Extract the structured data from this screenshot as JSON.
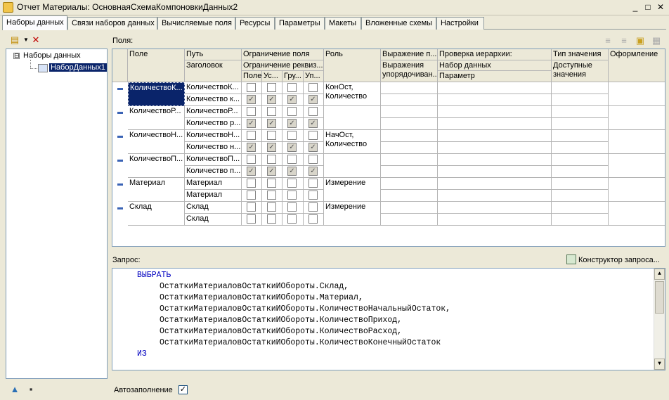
{
  "window": {
    "title": "Отчет Материалы: ОсновнаяСхемаКомпоновкиДанных2",
    "minimize": "_",
    "maximize": "□",
    "close": "✕"
  },
  "tabs": [
    {
      "label": "Наборы данных"
    },
    {
      "label": "Связи наборов данных"
    },
    {
      "label": "Вычисляемые поля"
    },
    {
      "label": "Ресурсы"
    },
    {
      "label": "Параметры"
    },
    {
      "label": "Макеты"
    },
    {
      "label": "Вложенные схемы"
    },
    {
      "label": "Настройки"
    }
  ],
  "tree": {
    "root": "Наборы данных",
    "child": "НаборДанных1",
    "expander": "⊟"
  },
  "fields_label": "Поля:",
  "grid": {
    "headers": {
      "field": "Поле",
      "path": "Путь",
      "title": "Заголовок",
      "field_restriction": "Ограничение поля",
      "attr_restriction": "Ограничение реквиз...",
      "sub_field": "Поле",
      "sub_cond": "Ус...",
      "sub_group": "Гру...",
      "sub_order": "Уп...",
      "role": "Роль",
      "expr": "Выражение п...",
      "expr_order": "Выражения упорядочиван...",
      "hier": "Проверка иерархии:",
      "hier_set": "Набор данных",
      "hier_param": "Параметр",
      "value_type": "Тип значения",
      "avail_values": "Доступные значения",
      "format": "Оформление"
    },
    "rows": [
      {
        "field": "КоличествоК...",
        "path": "КоличествоК...",
        "title": "Количество к...",
        "role": "КонОст, Количество",
        "top": [
          false,
          false,
          false,
          false
        ],
        "bottom": [
          true,
          true,
          true,
          true
        ],
        "selected": true
      },
      {
        "field": "КоличествоР...",
        "path": "КоличествоР...",
        "title": "Количество р...",
        "role": "",
        "top": [
          false,
          false,
          false,
          false
        ],
        "bottom": [
          true,
          true,
          true,
          true
        ],
        "selected": false
      },
      {
        "field": "КоличествоН...",
        "path": "КоличествоН...",
        "title": "Количество н...",
        "role": "НачОст, Количество",
        "top": [
          false,
          false,
          false,
          false
        ],
        "bottom": [
          true,
          true,
          true,
          true
        ],
        "selected": false
      },
      {
        "field": "КоличествоП...",
        "path": "КоличествоП...",
        "title": "Количество п...",
        "role": "",
        "top": [
          false,
          false,
          false,
          false
        ],
        "bottom": [
          true,
          true,
          true,
          true
        ],
        "selected": false
      },
      {
        "field": "Материал",
        "path": "Материал",
        "title": "Материал",
        "role": "Измерение",
        "top": [
          false,
          false,
          false,
          false
        ],
        "bottom": [
          false,
          false,
          false,
          false
        ],
        "selected": false
      },
      {
        "field": "Склад",
        "path": "Склад",
        "title": "Склад",
        "role": "Измерение",
        "top": [
          false,
          false,
          false,
          false
        ],
        "bottom": [
          false,
          false,
          false,
          false
        ],
        "selected": false
      }
    ]
  },
  "query": {
    "label": "Запрос:",
    "constructor_button": "Конструктор запроса...",
    "lines": [
      {
        "text": "ВЫБРАТЬ",
        "kw": true,
        "indent": 0
      },
      {
        "text": "ОстаткиМатериаловОстаткиИОбороты.Склад,",
        "kw": false,
        "indent": 1
      },
      {
        "text": "ОстаткиМатериаловОстаткиИОбороты.Материал,",
        "kw": false,
        "indent": 1
      },
      {
        "text": "ОстаткиМатериаловОстаткиИОбороты.КоличествоНачальныйОстаток,",
        "kw": false,
        "indent": 1
      },
      {
        "text": "ОстаткиМатериаловОстаткиИОбороты.КоличествоПриход,",
        "kw": false,
        "indent": 1
      },
      {
        "text": "ОстаткиМатериаловОстаткиИОбороты.КоличествоРасход,",
        "kw": false,
        "indent": 1
      },
      {
        "text": "ОстаткиМатериаловОстаткиИОбороты.КоличествоКонечныйОстаток",
        "kw": false,
        "indent": 1
      },
      {
        "text": "ИЗ",
        "kw": true,
        "indent": 0
      }
    ]
  },
  "autofill": {
    "label": "Автозаполнение",
    "checked": true,
    "mark": "✓"
  },
  "icons": {
    "check": "✓",
    "up": "▲",
    "down": "▼"
  }
}
